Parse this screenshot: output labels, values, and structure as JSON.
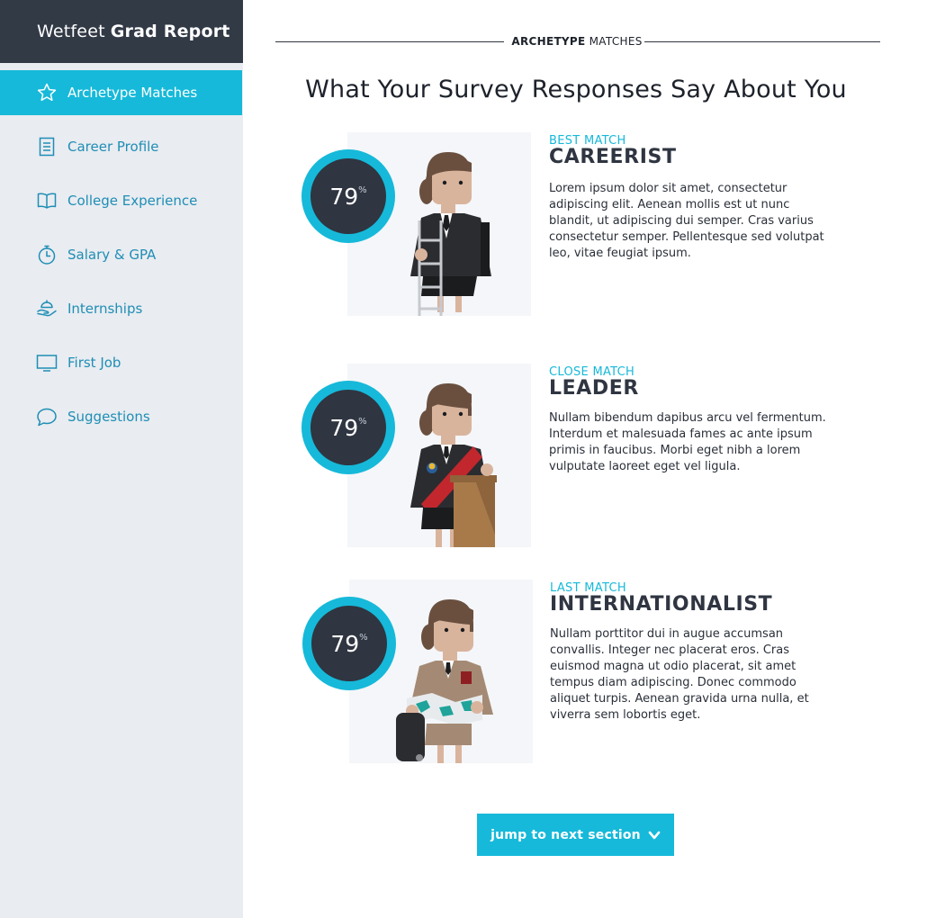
{
  "app": {
    "brand_light": "Wetfeet",
    "brand_bold": "Grad Report"
  },
  "sidebar": {
    "items": [
      {
        "label": "Archetype Matches",
        "icon": "star-icon",
        "active": true
      },
      {
        "label": "Career Profile",
        "icon": "document-icon",
        "active": false
      },
      {
        "label": "College Experience",
        "icon": "open-book-icon",
        "active": false
      },
      {
        "label": "Salary & GPA",
        "icon": "stopwatch-icon",
        "active": false
      },
      {
        "label": "Internships",
        "icon": "hand-tray-icon",
        "active": false
      },
      {
        "label": "First Job",
        "icon": "monitor-icon",
        "active": false
      },
      {
        "label": "Suggestions",
        "icon": "speech-bubble-icon",
        "active": false
      }
    ]
  },
  "section": {
    "tag_bold": "ARCHETYPE",
    "tag_light": "MATCHES",
    "title": "What Your Survey Responses Say About You"
  },
  "matches": [
    {
      "kind": "BEST MATCH",
      "name": "CAREERIST",
      "percent": "79",
      "percent_unit": "%",
      "score_fraction": 0.79,
      "illustration": "careerist-ladder-illustration",
      "description": "Lorem ipsum dolor sit amet, consectetur adipiscing elit. Aenean mollis est ut nunc blandit, ut adipiscing dui semper. Cras varius consectetur semper. Pellentesque sed volutpat leo, vitae feugiat ipsum."
    },
    {
      "kind": "CLOSE MATCH",
      "name": "LEADER",
      "percent": "79",
      "percent_unit": "%",
      "score_fraction": 0.79,
      "illustration": "leader-podium-illustration",
      "description": "Nullam bibendum dapibus arcu vel fermentum. Interdum et malesuada fames ac ante ipsum primis in faucibus. Morbi eget nibh a lorem vulputate laoreet eget vel ligula."
    },
    {
      "kind": "LAST MATCH",
      "name": "INTERNATIONALIST",
      "percent": "79",
      "percent_unit": "%",
      "score_fraction": 0.79,
      "illustration": "internationalist-map-illustration",
      "description": "Nullam porttitor dui in augue accumsan convallis. Integer nec placerat eros. Cras euismod magna ut odio placerat, sit amet tempus diam adipiscing. Donec commodo aliquet turpis. Aenean gravida urna nulla, et viverra sem lobortis eget."
    }
  ],
  "next_button": {
    "label": "jump to next section",
    "icon": "chevron-down-icon"
  },
  "colors": {
    "accent": "#16b9d9",
    "dark": "#323a46",
    "ring_track": "#2f3541",
    "sidebar_bg": "#e9ecf1"
  }
}
